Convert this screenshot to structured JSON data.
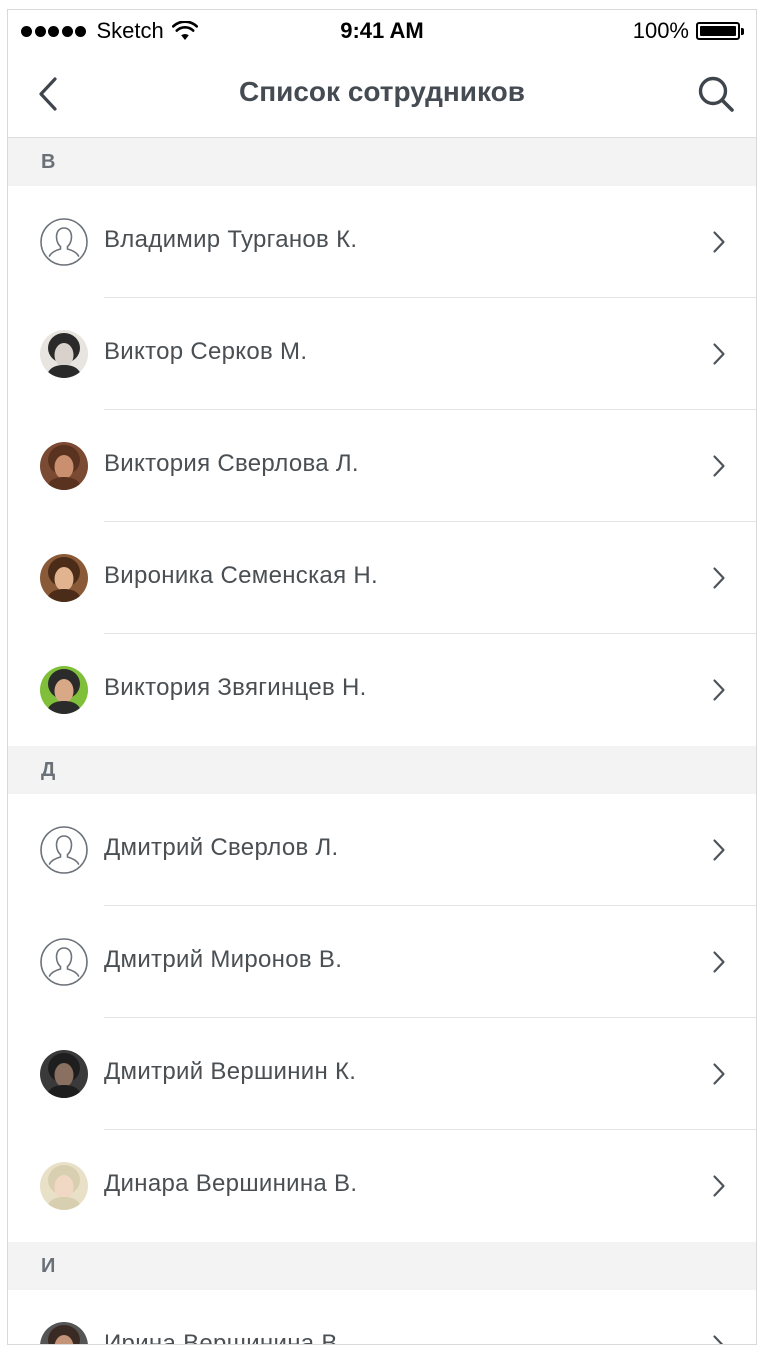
{
  "status_bar": {
    "carrier": "Sketch",
    "time": "9:41 AM",
    "battery": "100%"
  },
  "nav": {
    "title": "Список сотрудников"
  },
  "sections": [
    {
      "letter": "В",
      "employees": [
        {
          "name": "Владимир Турганов К.",
          "avatar": "placeholder"
        },
        {
          "name": "Виктор Серков М.",
          "avatar": "photo"
        },
        {
          "name": "Виктория Сверлова Л.",
          "avatar": "photo"
        },
        {
          "name": "Вироника Семенская Н.",
          "avatar": "photo"
        },
        {
          "name": "Виктория Звягинцев Н.",
          "avatar": "photo"
        }
      ]
    },
    {
      "letter": "Д",
      "employees": [
        {
          "name": "Дмитрий Сверлов Л.",
          "avatar": "placeholder"
        },
        {
          "name": "Дмитрий Миронов В.",
          "avatar": "placeholder"
        },
        {
          "name": "Дмитрий Вершинин К.",
          "avatar": "photo"
        },
        {
          "name": "Динара Вершинина В.",
          "avatar": "photo"
        }
      ]
    },
    {
      "letter": "И",
      "employees": [
        {
          "name": "Ирина Вершинина В.",
          "avatar": "photo"
        }
      ]
    }
  ],
  "colors": {
    "section_bg": "#f3f3f3",
    "text": "#4a4f54",
    "icon": "#3f454c"
  },
  "icons": {
    "back": "chevron-left-icon",
    "search": "search-icon",
    "row_chevron": "chevron-right-icon",
    "placeholder_avatar": "user-outline-icon"
  }
}
